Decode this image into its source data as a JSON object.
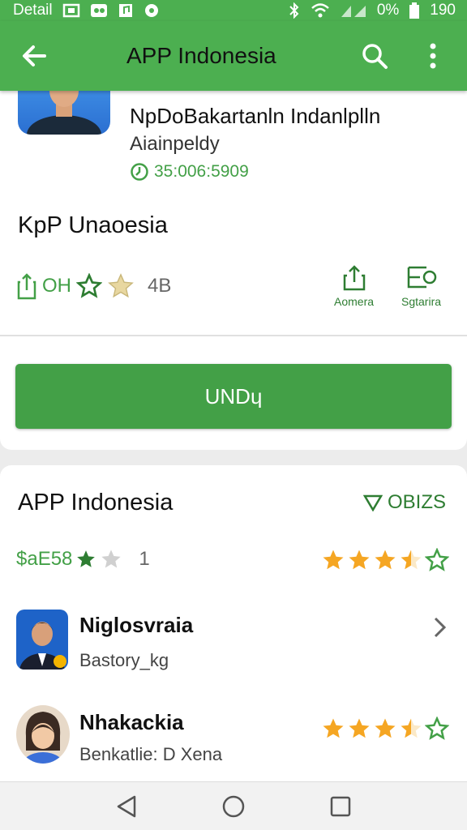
{
  "status_bar": {
    "left_text": "Detail",
    "battery_text": "0%",
    "time": "190"
  },
  "app_bar": {
    "title": "APP Indonesia"
  },
  "app_header": {
    "name": "NpDoBakartanln Indanlplln",
    "subtitle": "Aiainpeldy",
    "meta": "35:006:5909",
    "heading": "KpP Unaoesia"
  },
  "stats": {
    "label": "OH",
    "count": "4B"
  },
  "actions": [
    {
      "label": "Aomera"
    },
    {
      "label": "Sgtarira"
    }
  ],
  "install_button": {
    "label": "UNDɥ"
  },
  "section": {
    "title": "APP Indonesia",
    "badge": "OBIZS",
    "rating_label": "$aE58",
    "rating_count": "1",
    "stars": 3.5
  },
  "list": [
    {
      "name": "Niglosvraia",
      "subtitle": "Bastory_kg"
    },
    {
      "name": "Nhakackia",
      "subtitle": "Benkatlie: D Xena",
      "stars": 3.5
    }
  ],
  "colors": {
    "primary": "#4caf50",
    "button": "#43a047",
    "star": "#f5a623"
  }
}
